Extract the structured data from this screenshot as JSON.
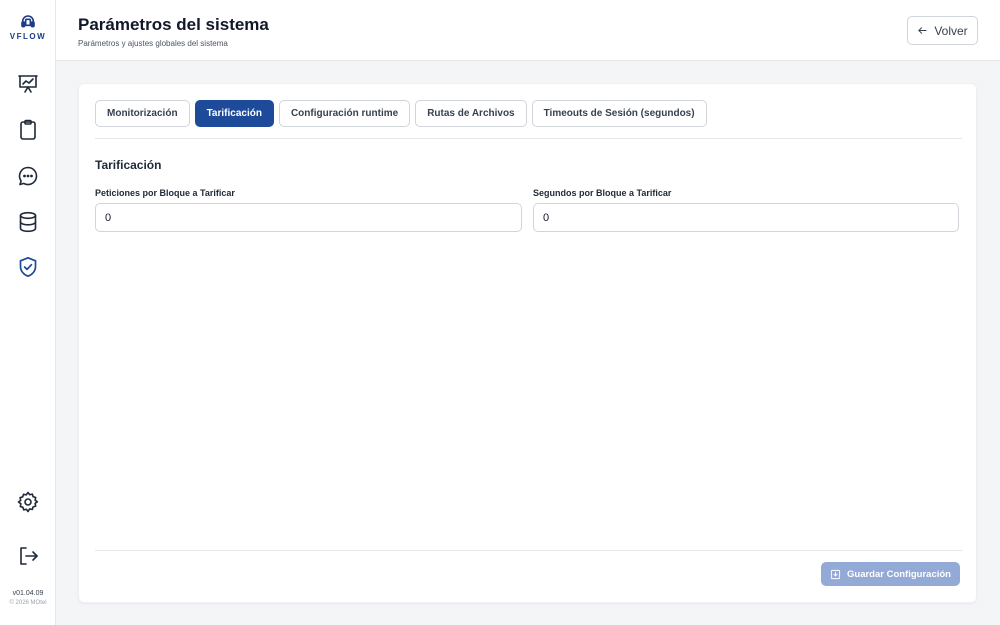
{
  "sidebar": {
    "logo_text": "VFLOW",
    "nav_icons": [
      "presentation-chart-icon",
      "clipboard-icon",
      "chat-bubble-icon",
      "database-icon",
      "shield-check-icon"
    ],
    "settings_icon": "gear-icon",
    "logout_icon": "logout-icon",
    "version": "v01.04.09",
    "copyright": "© 2026 MOtel"
  },
  "header": {
    "title": "Parámetros del sistema",
    "subtitle": "Parámetros y ajustes globales del sistema",
    "back_label": "Volver",
    "back_icon": "arrow-left-icon"
  },
  "tabs": [
    {
      "label": "Monitorización",
      "active": false
    },
    {
      "label": "Tarificación",
      "active": true
    },
    {
      "label": "Configuración runtime",
      "active": false
    },
    {
      "label": "Rutas de Archivos",
      "active": false
    },
    {
      "label": "Timeouts de Sesión (segundos)",
      "active": false
    }
  ],
  "section": {
    "title": "Tarificación",
    "fields": [
      {
        "label": "Peticiones por Bloque a Tarificar",
        "value": "0"
      },
      {
        "label": "Segundos por Bloque a Tarificar",
        "value": "0"
      }
    ]
  },
  "footer": {
    "save_label": "Guardar Configuración",
    "save_icon": "save-download-icon"
  },
  "colors": {
    "accent": "#1e4a9a",
    "save_disabled": "#93a9d6"
  }
}
